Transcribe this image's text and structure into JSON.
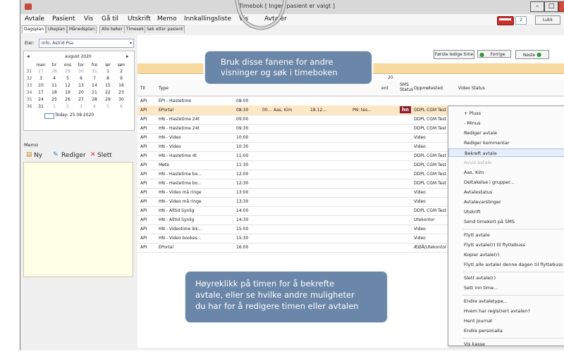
{
  "window": {
    "title_left": "Timebok",
    "title_right": "[ Ingen pasient er valgt ]",
    "minimize": "–",
    "maximize": "□",
    "close": "✕"
  },
  "menu": [
    "Avtale",
    "Pasient",
    "Vis",
    "Gå til",
    "Utskrift",
    "Memo",
    "Innkallingsliste",
    "Vis",
    "Avtaler"
  ],
  "tabs": [
    "Dagsplan",
    "Ukeplan",
    "Månedsplan",
    "Alle bøker",
    "Timesøk",
    "Søk etter pasient"
  ],
  "right_tools": {
    "count": "2",
    "lukk": "Lukk"
  },
  "owner": {
    "label": "Eier:",
    "value": "Info, Astrid Psa"
  },
  "calendar": {
    "month": "august 2020",
    "days": [
      "man",
      "tir",
      "ons",
      "tor",
      "fre",
      "lør",
      "søn"
    ],
    "weeks": [
      {
        "wk": "31",
        "d": [
          "27",
          "28",
          "29",
          "30",
          "31",
          "1",
          "2"
        ]
      },
      {
        "wk": "32",
        "d": [
          "3",
          "4",
          "5",
          "6",
          "7",
          "8",
          "9"
        ]
      },
      {
        "wk": "33",
        "d": [
          "10",
          "11",
          "12",
          "13",
          "14",
          "15",
          "16"
        ]
      },
      {
        "wk": "34",
        "d": [
          "17",
          "18",
          "19",
          "20",
          "21",
          "22",
          "23"
        ]
      },
      {
        "wk": "35",
        "d": [
          "24",
          "25",
          "26",
          "27",
          "28",
          "29",
          "30"
        ]
      },
      {
        "wk": "36",
        "d": [
          "31",
          "1",
          "2",
          "3",
          "4",
          "5",
          "6"
        ]
      }
    ],
    "today": "Today: 25.08.2020"
  },
  "memo": {
    "label": "Memo",
    "new": "Ny",
    "edit": "Rediger",
    "delete": "Slett"
  },
  "toolbar": {
    "first_free": "Første ledige time",
    "prev": "Forrige",
    "next": "Neste"
  },
  "date_hint": "20",
  "table": {
    "headers": {
      "til": "Til",
      "type": "Type",
      "oppmote": "Oppmøtested",
      "video": "Video Status",
      "sms": "SMS Status",
      "ent": "ent"
    },
    "rows": [
      {
        "til": "API",
        "type": "EPI - Hastetime",
        "time": "08:00",
        "ext": "",
        "name": "",
        "date": "",
        "note": "",
        "badge": "",
        "place": ""
      },
      {
        "til": "API",
        "type": "EPortal",
        "time": "08:30",
        "ext": "00...",
        "name": "Aas, Kim",
        "date": "18.12...",
        "note": "PN: tes...",
        "badge": "hn",
        "place": "DDPL CGM Test"
      },
      {
        "til": "API",
        "type": "HN - Hastetime 24t",
        "time": "09:00",
        "ext": "",
        "name": "",
        "date": "",
        "note": "",
        "badge": "",
        "place": "DDPL CGM Test"
      },
      {
        "til": "API",
        "type": "HN - Hastetime 24t",
        "time": "09:30",
        "ext": "",
        "name": "",
        "date": "",
        "note": "",
        "badge": "",
        "place": "DDPL CGM Test"
      },
      {
        "til": "API",
        "type": "HN - Video",
        "time": "10:00",
        "ext": "",
        "name": "",
        "date": "",
        "note": "",
        "badge": "",
        "place": "Video"
      },
      {
        "til": "API",
        "type": "HN - Video",
        "time": "10:30",
        "ext": "",
        "name": "",
        "date": "",
        "note": "",
        "badge": "",
        "place": "Video"
      },
      {
        "til": "API",
        "type": "HN - Hastetime 4t",
        "time": "11:00",
        "ext": "",
        "name": "",
        "date": "",
        "note": "",
        "badge": "",
        "place": "DDPL CGM Test"
      },
      {
        "til": "API",
        "type": "Møte",
        "time": "11:30",
        "ext": "",
        "name": "",
        "date": "",
        "note": "",
        "badge": "",
        "place": "DDPL CGM Test"
      },
      {
        "til": "API",
        "type": "HN - Hastetime bo...",
        "time": "12:00",
        "ext": "",
        "name": "",
        "date": "",
        "note": "",
        "badge": "",
        "place": "DDPL CGM Test"
      },
      {
        "til": "API",
        "type": "HN - Hastetime bo...",
        "time": "12:30",
        "ext": "",
        "name": "",
        "date": "",
        "note": "",
        "badge": "",
        "place": "DDPL CGM Test"
      },
      {
        "til": "API",
        "type": "HN - Video må ringe",
        "time": "13:00",
        "ext": "",
        "name": "",
        "date": "",
        "note": "",
        "badge": "",
        "place": "Video"
      },
      {
        "til": "API",
        "type": "HN - Video må ringe",
        "time": "13:30",
        "ext": "",
        "name": "",
        "date": "",
        "note": "",
        "badge": "",
        "place": "Video"
      },
      {
        "til": "API",
        "type": "HN - Alltid Synlig",
        "time": "14:00",
        "ext": "",
        "name": "",
        "date": "",
        "note": "",
        "badge": "",
        "place": "DDPL CGM Test"
      },
      {
        "til": "API",
        "type": "HN - Alltid Synlig",
        "time": "14:30",
        "ext": "",
        "name": "",
        "date": "",
        "note": "",
        "badge": "",
        "place": "Utekontor"
      },
      {
        "til": "API",
        "type": "HN - Videotime ikk...",
        "time": "15:00",
        "ext": "",
        "name": "",
        "date": "",
        "note": "",
        "badge": "",
        "place": "Video"
      },
      {
        "til": "API",
        "type": "HN - Video bookes...",
        "time": "15:30",
        "ext": "",
        "name": "",
        "date": "",
        "note": "",
        "badge": "",
        "place": "Video"
      },
      {
        "til": "API",
        "type": "EPortal",
        "time": "16:00",
        "ext": "",
        "name": "",
        "date": "",
        "note": "",
        "badge": "",
        "place": "ÆØÅ/Utekontor"
      }
    ]
  },
  "context_menu": {
    "items": [
      {
        "label": "+ Pluss",
        "sub": false,
        "state": "normal"
      },
      {
        "label": "- Minus",
        "sub": false,
        "state": "normal"
      },
      {
        "label": "Rediger avtale",
        "sub": false,
        "state": "normal"
      },
      {
        "label": "Rediger kommentar",
        "sub": false,
        "state": "normal"
      },
      {
        "label": "Bekreft avtale",
        "sub": false,
        "state": "highlight"
      },
      {
        "label": "Avvis avtale",
        "sub": false,
        "state": "dim"
      },
      {
        "label": "Aas, Kim",
        "sub": true,
        "state": "normal"
      },
      {
        "label": "Deltakelse i grupper...",
        "sub": false,
        "state": "normal"
      },
      {
        "label": "Avtalestatus",
        "sub": true,
        "state": "normal"
      },
      {
        "label": "Avtalevarslinger",
        "sub": false,
        "state": "normal"
      },
      {
        "label": "Utskrift",
        "sub": true,
        "state": "normal"
      },
      {
        "label": "Send timekort på SMS",
        "sub": false,
        "state": "normal"
      },
      {
        "label": "Flytt avtale",
        "sub": false,
        "state": "normal",
        "sep_before": true
      },
      {
        "label": "Flytt avtale(r) til flyttebuss",
        "sub": false,
        "state": "normal"
      },
      {
        "label": "Kopier avtale(r)",
        "sub": false,
        "state": "normal"
      },
      {
        "label": "Flytt alle avtaler denne dagen til flyttebuss",
        "sub": false,
        "state": "normal"
      },
      {
        "label": "Slett avtale(r)",
        "sub": false,
        "state": "normal",
        "sep_before": true
      },
      {
        "label": "Sett inn time...",
        "sub": false,
        "state": "normal"
      },
      {
        "label": "Endre avtaletype...",
        "sub": true,
        "state": "normal",
        "sep_before": true
      },
      {
        "label": "Hvem har registrert avtalen?",
        "sub": false,
        "state": "normal"
      },
      {
        "label": "Hent journal",
        "sub": false,
        "state": "normal"
      },
      {
        "label": "Endre personalia",
        "sub": false,
        "state": "normal"
      },
      {
        "label": "Vis kasse",
        "sub": false,
        "state": "normal",
        "sep_before": true
      }
    ]
  },
  "callouts": {
    "top": [
      "Bruk disse fanene for andre",
      "visninger og søk i timeboken"
    ],
    "bottom": [
      "Høyreklikk på timen for å bekrefte",
      "avtale, eller se hvilke andre muligheter",
      "du har for å redigere timen eller avtalen"
    ]
  },
  "colors": {
    "highlight_row": "#fde7c5",
    "band": "#f8d9a0",
    "badge": "#8c1c2e",
    "callout": "#6a86a8"
  }
}
